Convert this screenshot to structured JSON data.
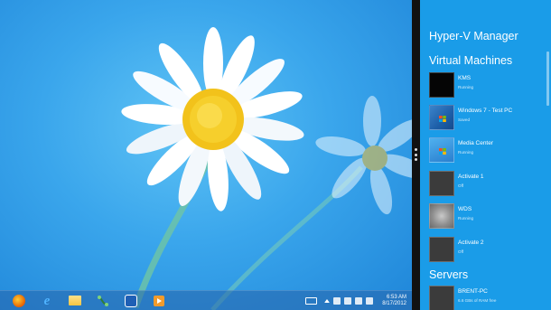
{
  "taskbar": {
    "items": [
      {
        "icon": "firefox-icon",
        "color": "#e66000"
      },
      {
        "icon": "internet-explorer-icon",
        "color": "#1e90ff"
      },
      {
        "icon": "file-explorer-icon",
        "color": "#f4c542"
      },
      {
        "icon": "network-tool-icon",
        "color": "#2f7d3a"
      },
      {
        "icon": "outlook-icon",
        "color": "#1f5fb5"
      },
      {
        "icon": "media-player-icon",
        "color": "#f29b2b"
      }
    ],
    "clock": {
      "time": "6:53 AM",
      "date": "8/17/2012"
    }
  },
  "hyperv": {
    "app_title": "Hyper-V Manager",
    "vm_section_title": "Virtual Machines",
    "servers_section_title": "Servers",
    "accent_color": "#1a9ce8",
    "vms": [
      {
        "name": "KMS",
        "status": "Running"
      },
      {
        "name": "Windows 7 - Test PC",
        "status": "Saved"
      },
      {
        "name": "Media Center",
        "status": "Running"
      },
      {
        "name": "Activate 1",
        "status": "Off"
      },
      {
        "name": "WDS",
        "status": "Running"
      },
      {
        "name": "Activate 2",
        "status": "Off"
      }
    ],
    "servers": [
      {
        "name": "BRENT-PC",
        "status": "6.6 GBs of RAM free"
      }
    ]
  }
}
